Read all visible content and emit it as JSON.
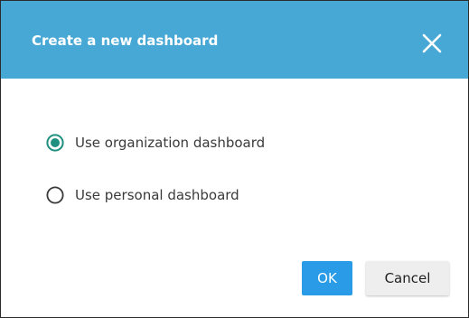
{
  "dialog": {
    "title": "Create a new dashboard",
    "close_icon": "close-x-icon",
    "options": [
      {
        "label": "Use organization dashboard",
        "selected": true
      },
      {
        "label": "Use personal dashboard",
        "selected": false
      }
    ],
    "buttons": {
      "ok_label": "OK",
      "cancel_label": "Cancel"
    }
  },
  "colors": {
    "header_bg": "#47a8d5",
    "radio_selected": "#1f8f7f",
    "ok_bg": "#2a9be6",
    "cancel_bg": "#eeeeee"
  }
}
